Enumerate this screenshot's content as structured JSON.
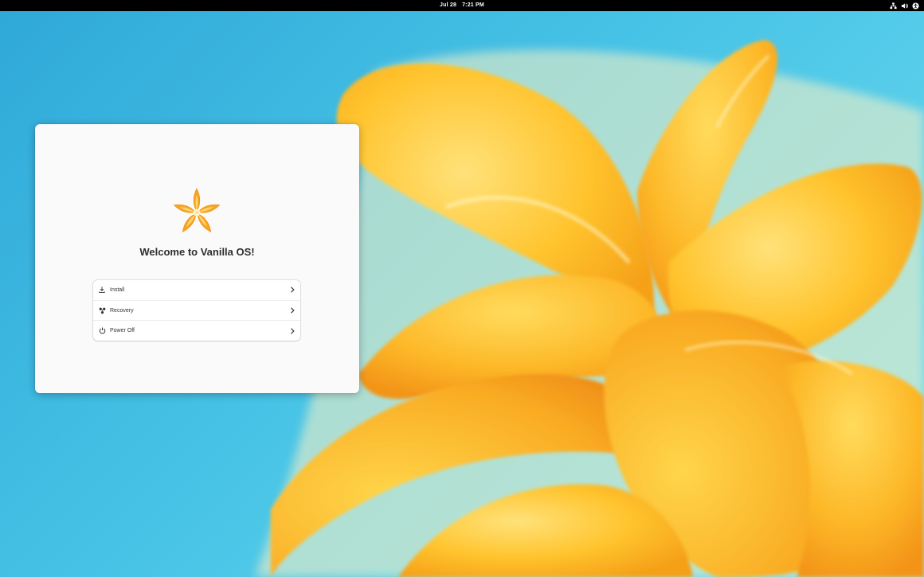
{
  "topbar": {
    "date": "Jul 28",
    "time": "7:21 PM",
    "tray_icons": [
      "network-icon",
      "volume-icon",
      "accessibility-icon"
    ]
  },
  "welcome_window": {
    "title": "Welcome to Vanilla OS!",
    "logo": "vanilla-flower-logo",
    "options": [
      {
        "label": "Install",
        "icon": "download-icon"
      },
      {
        "label": "Recovery",
        "icon": "recovery-icon"
      },
      {
        "label": "Power Off",
        "icon": "power-icon"
      }
    ]
  },
  "colors": {
    "topbar_bg": "#000000",
    "window_bg": "#fafafa",
    "logo_orange": "#f6a623",
    "wallpaper_sky": "#3fb6e3",
    "wallpaper_petal": "#ffc42e"
  }
}
